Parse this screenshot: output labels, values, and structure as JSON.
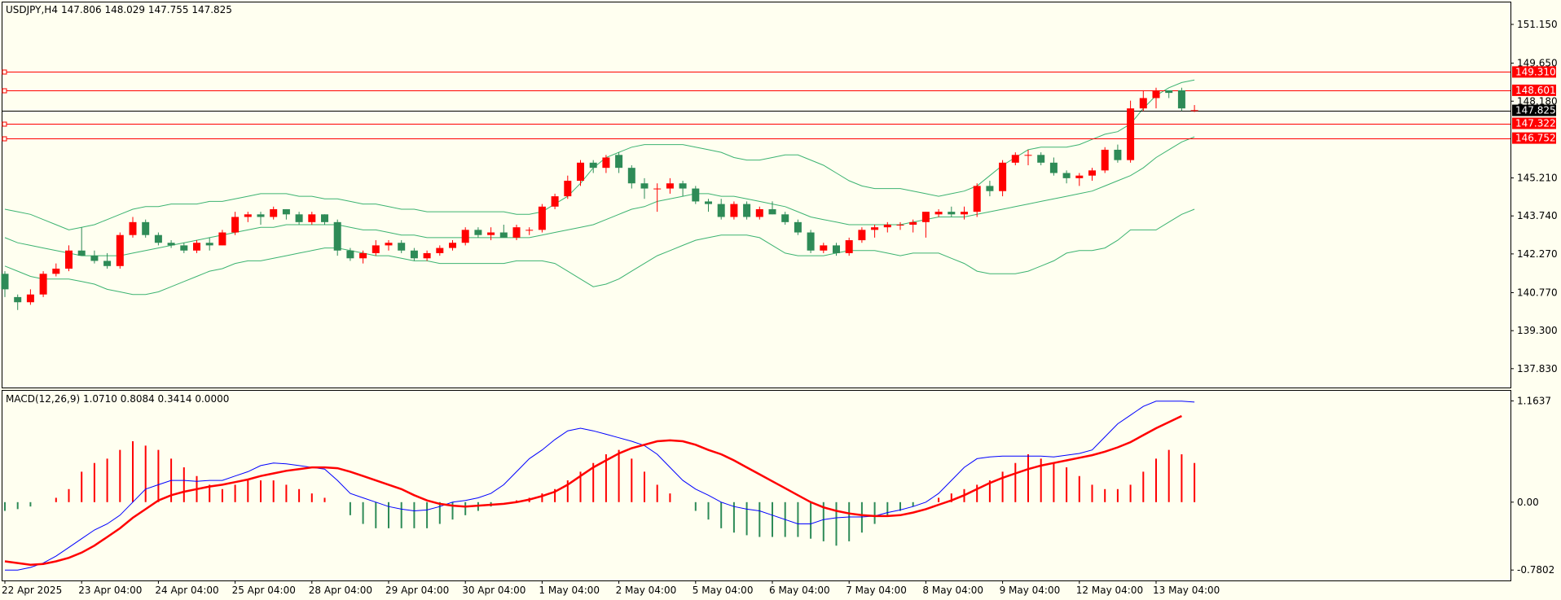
{
  "header": {
    "symbol": "USDJPY,H4",
    "ohlc": "147.806 148.029 147.755 147.825"
  },
  "macd_header": {
    "text": "MACD(12,26,9) 1.0710 0.8084 0.3414 0.0000"
  },
  "colors": {
    "background": "#fffff0",
    "bull": "#2e8b57",
    "bear": "#ff0000",
    "band": "#3cb371",
    "hline": "#ff0000",
    "price_line": "#000000",
    "macd_main": "#0000ff",
    "macd_signal": "#ff0000"
  },
  "price_axis": {
    "min": 137.1,
    "max": 152.0,
    "ticks": [
      "151.150",
      "149.650",
      "148.180",
      "145.210",
      "143.740",
      "142.270",
      "140.770",
      "139.300",
      "137.830"
    ]
  },
  "macd_axis": {
    "min": -0.9,
    "max": 1.28,
    "ticks": [
      "1.1637",
      "0.00",
      "-0.7802"
    ]
  },
  "price_tags": [
    {
      "value": 149.31,
      "label": "149.310",
      "color": "#ff0000"
    },
    {
      "value": 148.601,
      "label": "148.601",
      "color": "#ff0000"
    },
    {
      "value": 147.825,
      "label": "147.825",
      "color": "#000000"
    },
    {
      "value": 147.322,
      "label": "147.322",
      "color": "#ff0000"
    },
    {
      "value": 146.752,
      "label": "146.752",
      "color": "#ff0000"
    }
  ],
  "time_axis": {
    "labels": [
      "22 Apr 2025",
      "23 Apr 04:00",
      "24 Apr 04:00",
      "25 Apr 04:00",
      "28 Apr 04:00",
      "29 Apr 04:00",
      "30 Apr 04:00",
      "1 May 04:00",
      "2 May 04:00",
      "5 May 04:00",
      "6 May 04:00",
      "7 May 04:00",
      "8 May 04:00",
      "9 May 04:00",
      "12 May 04:00",
      "13 May 04:00"
    ]
  },
  "chart_data": {
    "type": "candlestick",
    "symbol": "USDJPY",
    "timeframe": "H4",
    "candles": [
      [
        141.5,
        141.6,
        140.6,
        140.9
      ],
      [
        140.6,
        140.7,
        140.1,
        140.4
      ],
      [
        140.4,
        140.9,
        140.3,
        140.7
      ],
      [
        140.7,
        141.6,
        140.6,
        141.5
      ],
      [
        141.5,
        141.9,
        141.4,
        141.7
      ],
      [
        141.7,
        142.6,
        141.6,
        142.4
      ],
      [
        142.4,
        143.3,
        142.2,
        142.2
      ],
      [
        142.2,
        142.4,
        141.9,
        142.0
      ],
      [
        142.0,
        142.3,
        141.7,
        141.8
      ],
      [
        141.8,
        143.1,
        141.7,
        143.0
      ],
      [
        143.0,
        143.7,
        142.9,
        143.5
      ],
      [
        143.5,
        143.6,
        142.9,
        143.0
      ],
      [
        143.0,
        143.1,
        142.6,
        142.7
      ],
      [
        142.7,
        142.8,
        142.5,
        142.6
      ],
      [
        142.6,
        142.7,
        142.3,
        142.4
      ],
      [
        142.4,
        142.8,
        142.3,
        142.7
      ],
      [
        142.7,
        142.9,
        142.4,
        142.6
      ],
      [
        142.6,
        143.2,
        142.6,
        143.1
      ],
      [
        143.1,
        143.9,
        143.0,
        143.7
      ],
      [
        143.7,
        143.9,
        143.5,
        143.8
      ],
      [
        143.8,
        143.9,
        143.4,
        143.7
      ],
      [
        143.7,
        144.1,
        143.6,
        144.0
      ],
      [
        144.0,
        144.0,
        143.6,
        143.8
      ],
      [
        143.8,
        143.9,
        143.4,
        143.5
      ],
      [
        143.5,
        143.9,
        143.4,
        143.8
      ],
      [
        143.8,
        143.8,
        143.4,
        143.5
      ],
      [
        143.5,
        143.6,
        142.2,
        142.4
      ],
      [
        142.4,
        142.5,
        142.0,
        142.1
      ],
      [
        142.1,
        142.4,
        141.9,
        142.3
      ],
      [
        142.3,
        142.8,
        142.2,
        142.6
      ],
      [
        142.6,
        142.8,
        142.4,
        142.7
      ],
      [
        142.7,
        142.8,
        142.3,
        142.4
      ],
      [
        142.4,
        142.5,
        142.0,
        142.1
      ],
      [
        142.1,
        142.4,
        142.0,
        142.3
      ],
      [
        142.3,
        142.6,
        142.2,
        142.5
      ],
      [
        142.5,
        142.8,
        142.4,
        142.7
      ],
      [
        142.7,
        143.3,
        142.6,
        143.2
      ],
      [
        143.2,
        143.3,
        142.9,
        143.0
      ],
      [
        143.0,
        143.3,
        142.8,
        143.1
      ],
      [
        143.1,
        143.4,
        142.9,
        142.9
      ],
      [
        142.9,
        143.4,
        142.8,
        143.3
      ],
      [
        143.2,
        143.3,
        143.0,
        143.2
      ],
      [
        143.2,
        144.2,
        143.1,
        144.1
      ],
      [
        144.1,
        144.6,
        144.0,
        144.5
      ],
      [
        144.5,
        145.3,
        144.4,
        145.1
      ],
      [
        145.1,
        145.9,
        144.9,
        145.8
      ],
      [
        145.8,
        145.9,
        145.4,
        145.6
      ],
      [
        145.6,
        146.1,
        145.4,
        146.0
      ],
      [
        146.1,
        146.2,
        145.4,
        145.6
      ],
      [
        145.6,
        145.7,
        144.8,
        145.0
      ],
      [
        145.0,
        145.2,
        144.4,
        144.8
      ],
      [
        144.8,
        145.0,
        143.9,
        144.8
      ],
      [
        144.8,
        145.2,
        144.6,
        145.0
      ],
      [
        145.0,
        145.1,
        144.5,
        144.8
      ],
      [
        144.8,
        144.9,
        144.2,
        144.3
      ],
      [
        144.3,
        144.4,
        143.9,
        144.2
      ],
      [
        144.2,
        144.4,
        143.6,
        143.7
      ],
      [
        143.7,
        144.3,
        143.6,
        144.2
      ],
      [
        144.2,
        144.3,
        143.6,
        143.7
      ],
      [
        143.7,
        144.1,
        143.6,
        144.0
      ],
      [
        144.0,
        144.3,
        143.8,
        143.8
      ],
      [
        143.8,
        143.9,
        143.4,
        143.5
      ],
      [
        143.5,
        143.6,
        143.0,
        143.1
      ],
      [
        143.1,
        143.2,
        142.3,
        142.4
      ],
      [
        142.4,
        142.7,
        142.3,
        142.6
      ],
      [
        142.6,
        142.7,
        142.2,
        142.3
      ],
      [
        142.3,
        142.9,
        142.2,
        142.8
      ],
      [
        142.8,
        143.3,
        142.7,
        143.2
      ],
      [
        143.2,
        143.4,
        142.9,
        143.3
      ],
      [
        143.3,
        143.5,
        143.1,
        143.4
      ],
      [
        143.4,
        143.5,
        143.2,
        143.4
      ],
      [
        143.4,
        143.6,
        143.1,
        143.5
      ],
      [
        143.5,
        143.9,
        142.9,
        143.9
      ],
      [
        143.8,
        144.0,
        143.7,
        143.9
      ],
      [
        143.9,
        144.1,
        143.7,
        143.8
      ],
      [
        143.8,
        144.1,
        143.6,
        143.9
      ],
      [
        143.9,
        145.0,
        143.7,
        144.9
      ],
      [
        144.9,
        145.1,
        144.5,
        144.7
      ],
      [
        144.7,
        145.9,
        144.5,
        145.8
      ],
      [
        145.8,
        146.2,
        145.7,
        146.1
      ],
      [
        146.1,
        146.3,
        145.7,
        146.1
      ],
      [
        146.1,
        146.2,
        145.7,
        145.8
      ],
      [
        145.8,
        146.0,
        145.3,
        145.4
      ],
      [
        145.4,
        145.5,
        145.0,
        145.2
      ],
      [
        145.2,
        145.4,
        144.9,
        145.3
      ],
      [
        145.3,
        145.6,
        145.1,
        145.5
      ],
      [
        145.5,
        146.4,
        145.4,
        146.3
      ],
      [
        146.3,
        146.5,
        145.8,
        145.9
      ],
      [
        145.9,
        148.2,
        145.8,
        147.9
      ],
      [
        147.9,
        148.6,
        147.8,
        148.3
      ],
      [
        148.3,
        148.7,
        147.9,
        148.6
      ],
      [
        148.6,
        148.6,
        148.3,
        148.5
      ],
      [
        148.6,
        148.7,
        147.8,
        147.9
      ],
      [
        147.81,
        148.03,
        147.76,
        147.83
      ]
    ],
    "bollinger_upper": [
      144.0,
      143.9,
      143.8,
      143.6,
      143.4,
      143.2,
      143.3,
      143.4,
      143.6,
      143.8,
      144.0,
      144.1,
      144.1,
      144.2,
      144.2,
      144.2,
      144.3,
      144.3,
      144.4,
      144.5,
      144.6,
      144.6,
      144.6,
      144.5,
      144.5,
      144.4,
      144.4,
      144.3,
      144.2,
      144.2,
      144.1,
      144.0,
      144.0,
      143.9,
      143.9,
      143.9,
      143.9,
      143.9,
      143.9,
      143.9,
      143.8,
      143.8,
      143.9,
      144.2,
      144.5,
      145.0,
      145.6,
      146.0,
      146.2,
      146.4,
      146.5,
      146.5,
      146.5,
      146.5,
      146.4,
      146.3,
      146.2,
      146.0,
      145.9,
      145.9,
      146.0,
      146.1,
      146.1,
      145.9,
      145.7,
      145.4,
      145.1,
      144.9,
      144.8,
      144.8,
      144.8,
      144.7,
      144.6,
      144.5,
      144.6,
      144.7,
      144.9,
      145.3,
      145.7,
      146.0,
      146.3,
      146.4,
      146.4,
      146.4,
      146.5,
      146.7,
      146.9,
      147.0,
      147.3,
      147.9,
      148.4,
      148.7,
      148.9,
      149.0
    ],
    "bollinger_mid": [
      142.9,
      142.7,
      142.6,
      142.5,
      142.4,
      142.3,
      142.2,
      142.2,
      142.2,
      142.2,
      142.3,
      142.4,
      142.5,
      142.6,
      142.7,
      142.8,
      142.9,
      143.0,
      143.1,
      143.2,
      143.3,
      143.3,
      143.4,
      143.4,
      143.4,
      143.4,
      143.4,
      143.3,
      143.2,
      143.2,
      143.1,
      143.0,
      143.0,
      142.9,
      142.9,
      142.9,
      142.9,
      142.9,
      142.9,
      142.9,
      142.9,
      142.9,
      143.0,
      143.1,
      143.2,
      143.3,
      143.4,
      143.6,
      143.8,
      144.0,
      144.1,
      144.3,
      144.4,
      144.5,
      144.6,
      144.6,
      144.5,
      144.5,
      144.4,
      144.3,
      144.2,
      144.1,
      143.9,
      143.7,
      143.6,
      143.5,
      143.4,
      143.4,
      143.4,
      143.4,
      143.4,
      143.5,
      143.6,
      143.7,
      143.7,
      143.7,
      143.8,
      143.9,
      144.0,
      144.1,
      144.2,
      144.3,
      144.4,
      144.5,
      144.6,
      144.7,
      144.9,
      145.1,
      145.3,
      145.6,
      146.0,
      146.3,
      146.6,
      146.8
    ],
    "bollinger_lower": [
      141.8,
      141.6,
      141.4,
      141.3,
      141.3,
      141.3,
      141.2,
      141.1,
      140.9,
      140.8,
      140.7,
      140.7,
      140.8,
      141.0,
      141.2,
      141.4,
      141.6,
      141.7,
      141.9,
      142.0,
      142.0,
      142.1,
      142.2,
      142.3,
      142.4,
      142.5,
      142.5,
      142.4,
      142.3,
      142.2,
      142.2,
      142.1,
      142.0,
      142.0,
      141.9,
      141.9,
      141.9,
      141.9,
      141.9,
      141.9,
      142.0,
      142.0,
      142.0,
      141.9,
      141.6,
      141.3,
      141.0,
      141.1,
      141.3,
      141.6,
      141.9,
      142.2,
      142.4,
      142.6,
      142.8,
      142.9,
      143.0,
      143.0,
      143.0,
      142.9,
      142.6,
      142.3,
      142.2,
      142.2,
      142.2,
      142.3,
      142.4,
      142.4,
      142.4,
      142.3,
      142.2,
      142.3,
      142.3,
      142.3,
      142.1,
      141.9,
      141.6,
      141.5,
      141.5,
      141.5,
      141.6,
      141.8,
      142.0,
      142.3,
      142.4,
      142.4,
      142.5,
      142.8,
      143.2,
      143.2,
      143.2,
      143.5,
      143.8,
      144.0
    ],
    "macd": {
      "histogram": [
        -0.1,
        -0.08,
        -0.05,
        0.0,
        0.05,
        0.15,
        0.35,
        0.45,
        0.5,
        0.6,
        0.7,
        0.65,
        0.6,
        0.5,
        0.4,
        0.3,
        0.2,
        0.15,
        0.2,
        0.25,
        0.25,
        0.25,
        0.2,
        0.15,
        0.1,
        0.05,
        0.0,
        -0.15,
        -0.25,
        -0.3,
        -0.3,
        -0.3,
        -0.3,
        -0.3,
        -0.25,
        -0.2,
        -0.15,
        -0.1,
        -0.05,
        0.0,
        0.02,
        0.05,
        0.1,
        0.15,
        0.25,
        0.35,
        0.45,
        0.55,
        0.6,
        0.5,
        0.35,
        0.2,
        0.1,
        0.0,
        -0.1,
        -0.2,
        -0.3,
        -0.35,
        -0.38,
        -0.4,
        -0.4,
        -0.4,
        -0.4,
        -0.42,
        -0.45,
        -0.5,
        -0.45,
        -0.35,
        -0.25,
        -0.15,
        -0.1,
        -0.05,
        0.0,
        0.05,
        0.1,
        0.15,
        0.2,
        0.25,
        0.35,
        0.45,
        0.55,
        0.5,
        0.45,
        0.4,
        0.3,
        0.2,
        0.15,
        0.15,
        0.2,
        0.35,
        0.5,
        0.6,
        0.55,
        0.45
      ],
      "main": [
        -0.78,
        -0.78,
        -0.75,
        -0.7,
        -0.62,
        -0.52,
        -0.42,
        -0.32,
        -0.25,
        -0.15,
        0.0,
        0.15,
        0.2,
        0.25,
        0.25,
        0.24,
        0.25,
        0.25,
        0.3,
        0.35,
        0.42,
        0.45,
        0.44,
        0.42,
        0.4,
        0.38,
        0.25,
        0.1,
        0.05,
        0.0,
        -0.05,
        -0.08,
        -0.1,
        -0.09,
        -0.05,
        0.0,
        0.02,
        0.05,
        0.1,
        0.2,
        0.35,
        0.5,
        0.6,
        0.72,
        0.82,
        0.85,
        0.82,
        0.78,
        0.74,
        0.7,
        0.65,
        0.55,
        0.4,
        0.25,
        0.15,
        0.08,
        0.0,
        -0.05,
        -0.08,
        -0.1,
        -0.15,
        -0.2,
        -0.25,
        -0.25,
        -0.2,
        -0.18,
        -0.17,
        -0.17,
        -0.16,
        -0.12,
        -0.09,
        -0.05,
        0.0,
        0.1,
        0.25,
        0.4,
        0.5,
        0.52,
        0.53,
        0.53,
        0.53,
        0.53,
        0.52,
        0.54,
        0.56,
        0.6,
        0.75,
        0.9,
        1.0,
        1.1,
        1.16,
        1.16,
        1.16,
        1.15
      ],
      "signal": [
        -0.68,
        -0.7,
        -0.72,
        -0.71,
        -0.68,
        -0.64,
        -0.58,
        -0.5,
        -0.4,
        -0.3,
        -0.18,
        -0.08,
        0.02,
        0.08,
        0.12,
        0.15,
        0.18,
        0.2,
        0.23,
        0.26,
        0.3,
        0.33,
        0.36,
        0.38,
        0.4,
        0.4,
        0.39,
        0.35,
        0.3,
        0.25,
        0.2,
        0.15,
        0.08,
        0.02,
        -0.02,
        -0.04,
        -0.05,
        -0.04,
        -0.03,
        -0.02,
        0.0,
        0.03,
        0.07,
        0.12,
        0.2,
        0.3,
        0.4,
        0.48,
        0.56,
        0.62,
        0.66,
        0.7,
        0.71,
        0.7,
        0.66,
        0.6,
        0.55,
        0.48,
        0.4,
        0.32,
        0.24,
        0.16,
        0.08,
        0.0,
        -0.06,
        -0.1,
        -0.13,
        -0.15,
        -0.16,
        -0.16,
        -0.15,
        -0.12,
        -0.08,
        -0.03,
        0.02,
        0.08,
        0.15,
        0.22,
        0.28,
        0.33,
        0.38,
        0.42,
        0.45,
        0.48,
        0.51,
        0.54,
        0.58,
        0.63,
        0.69,
        0.77,
        0.85,
        0.92,
        0.99
      ]
    }
  }
}
